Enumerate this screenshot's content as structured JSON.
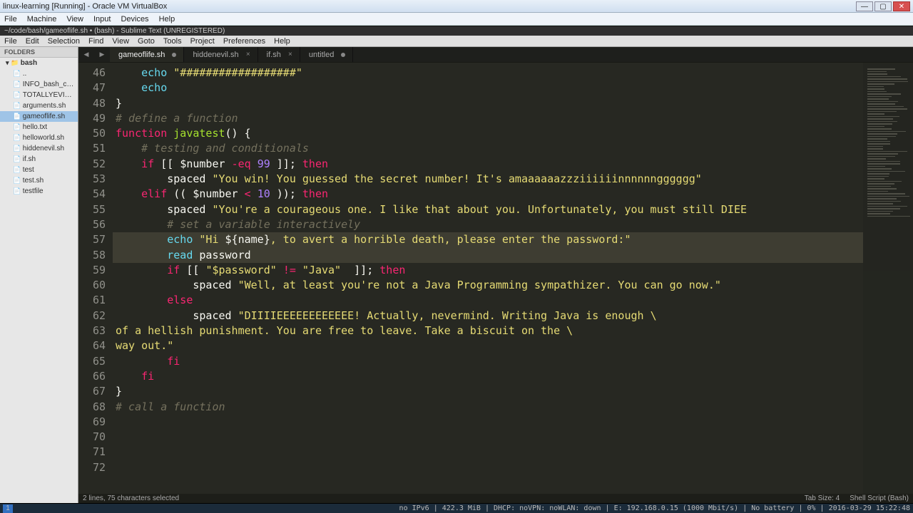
{
  "vbox": {
    "title": "linux-learning [Running] - Oracle VM VirtualBox",
    "menus": [
      "File",
      "Machine",
      "View",
      "Input",
      "Devices",
      "Help"
    ],
    "winbtns": {
      "min": "—",
      "max": "▢",
      "close": "✕"
    }
  },
  "sublime": {
    "title": "~/code/bash/gameoflife.sh • (bash) - Sublime Text (UNREGISTERED)",
    "menus": [
      "File",
      "Edit",
      "Selection",
      "Find",
      "View",
      "Goto",
      "Tools",
      "Project",
      "Preferences",
      "Help"
    ]
  },
  "sidebar": {
    "heading": "FOLDERS",
    "folder": "bash",
    "files": [
      {
        "name": "..",
        "selected": false
      },
      {
        "name": "INFO_bash_compar",
        "selected": false
      },
      {
        "name": "TOTALLYEVIL.sh",
        "selected": false
      },
      {
        "name": "arguments.sh",
        "selected": false
      },
      {
        "name": "gameoflife.sh",
        "selected": true
      },
      {
        "name": "hello.txt",
        "selected": false
      },
      {
        "name": "helloworld.sh",
        "selected": false
      },
      {
        "name": "hiddenevil.sh",
        "selected": false
      },
      {
        "name": "if.sh",
        "selected": false
      },
      {
        "name": "test",
        "selected": false
      },
      {
        "name": "test.sh",
        "selected": false
      },
      {
        "name": "testfile",
        "selected": false
      }
    ]
  },
  "tabs": [
    {
      "label": "gameoflife.sh",
      "active": true,
      "dirty": true
    },
    {
      "label": "hiddenevil.sh",
      "active": false,
      "dirty": false
    },
    {
      "label": "if.sh",
      "active": false,
      "dirty": false
    },
    {
      "label": "untitled",
      "active": false,
      "dirty": true
    }
  ],
  "code": {
    "first_line": 46,
    "highlight_lines": [
      59,
      60
    ],
    "lines": [
      [
        [
          "    ",
          ""
        ],
        [
          "echo",
          "builtin"
        ],
        [
          " ",
          ""
        ],
        [
          "\"##################\"",
          "str"
        ]
      ],
      [
        [
          "    ",
          ""
        ],
        [
          "echo",
          "builtin"
        ]
      ],
      [
        [
          "}",
          "punct"
        ]
      ],
      [
        [
          "",
          ""
        ]
      ],
      [
        [
          "# define a function",
          "cmt"
        ]
      ],
      [
        [
          "function",
          "kw"
        ],
        [
          " ",
          ""
        ],
        [
          "javatest",
          "fn"
        ],
        [
          "()",
          "punct"
        ],
        [
          " {",
          "punct"
        ]
      ],
      [
        [
          "    ",
          ""
        ],
        [
          "# testing and conditionals",
          "cmt"
        ]
      ],
      [
        [
          "    ",
          ""
        ],
        [
          "if",
          "kw"
        ],
        [
          " [[ ",
          ""
        ],
        [
          "$number",
          "var"
        ],
        [
          " ",
          ""
        ],
        [
          "-eq",
          "op"
        ],
        [
          " ",
          ""
        ],
        [
          "99",
          "num"
        ],
        [
          " ]]",
          ""
        ],
        [
          ";",
          ""
        ],
        [
          " ",
          ""
        ],
        [
          "then",
          "kw"
        ]
      ],
      [
        [
          "        ",
          ""
        ],
        [
          "spaced ",
          ""
        ],
        [
          "\"You win! You guessed the secret number! It's amaaaaaazzziiiiiinnnnnngggggg\"",
          "str"
        ]
      ],
      [
        [
          "    ",
          ""
        ],
        [
          "elif",
          "kw"
        ],
        [
          " (( ",
          ""
        ],
        [
          "$number",
          "var"
        ],
        [
          " ",
          ""
        ],
        [
          "<",
          "op"
        ],
        [
          " ",
          ""
        ],
        [
          "10",
          "num"
        ],
        [
          " ))",
          ""
        ],
        [
          ";",
          ""
        ],
        [
          " ",
          ""
        ],
        [
          "then",
          "kw"
        ]
      ],
      [
        [
          "        ",
          ""
        ],
        [
          "spaced ",
          ""
        ],
        [
          "\"You're a courageous one. I like that about you. Unfortunately, you must still DIEE",
          "str"
        ]
      ],
      [
        [
          "",
          ""
        ]
      ],
      [
        [
          "        ",
          ""
        ],
        [
          "# set a variable interactively",
          "cmt"
        ]
      ],
      [
        [
          "        ",
          ""
        ],
        [
          "echo",
          "builtin"
        ],
        [
          " ",
          ""
        ],
        [
          "\"Hi ",
          "str"
        ],
        [
          "${name}",
          "var"
        ],
        [
          ", to avert a horrible death, please enter the password:\"",
          "str"
        ]
      ],
      [
        [
          "        ",
          ""
        ],
        [
          "read",
          "builtin"
        ],
        [
          " password",
          ""
        ]
      ],
      [
        [
          "",
          ""
        ]
      ],
      [
        [
          "        ",
          ""
        ],
        [
          "if",
          "kw"
        ],
        [
          " [[ ",
          ""
        ],
        [
          "\"$password\"",
          "str"
        ],
        [
          " ",
          ""
        ],
        [
          "!=",
          "op"
        ],
        [
          " ",
          ""
        ],
        [
          "\"Java\"",
          "str"
        ],
        [
          "  ]]",
          ""
        ],
        [
          ";",
          ""
        ],
        [
          " ",
          ""
        ],
        [
          "then",
          "kw"
        ]
      ],
      [
        [
          "            ",
          ""
        ],
        [
          "spaced ",
          ""
        ],
        [
          "\"Well, at least you're not a Java Programming sympathizer. You can go now.\"",
          "str"
        ]
      ],
      [
        [
          "        ",
          ""
        ],
        [
          "else",
          "kw"
        ]
      ],
      [
        [
          "            ",
          ""
        ],
        [
          "spaced ",
          ""
        ],
        [
          "\"DIIIIEEEEEEEEEEEE! Actually, nevermind. Writing Java is enough \\",
          "str"
        ]
      ],
      [
        [
          "of a hellish punishment. You are free to leave. Take a biscuit on the \\",
          "str"
        ]
      ],
      [
        [
          "way out.\"",
          "str"
        ]
      ],
      [
        [
          "        ",
          ""
        ],
        [
          "fi",
          "kw"
        ]
      ],
      [
        [
          "    ",
          ""
        ],
        [
          "fi",
          "kw"
        ]
      ],
      [
        [
          "}",
          "punct"
        ]
      ],
      [
        [
          "",
          ""
        ]
      ],
      [
        [
          "# call a function",
          "cmt"
        ]
      ]
    ]
  },
  "status": {
    "left": "2 lines, 75 characters selected",
    "tab_size": "Tab Size: 4",
    "syntax": "Shell Script (Bash)"
  },
  "bottombar": {
    "workspace": "1",
    "right_text": "no IPv6 | 422.3 MiB | DHCP: noVPN: noWLAN: down | E: 192.168.0.15 (1000 Mbit/s) | No battery | 0% | 2016-03-29 15:22:48"
  }
}
